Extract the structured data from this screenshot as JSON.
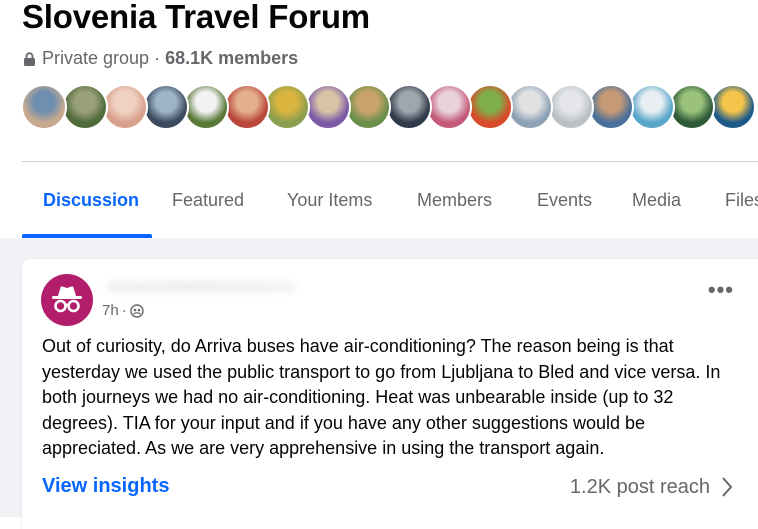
{
  "group": {
    "title": "Slovenia Travel Forum",
    "privacy": "Private group",
    "separator": "·",
    "members": "68.1K members"
  },
  "member_avatars": [
    {
      "colors": [
        "#c7a98f",
        "#6e8fb0"
      ]
    },
    {
      "colors": [
        "#4f6b3a",
        "#9aa07a"
      ]
    },
    {
      "colors": [
        "#d9a08c",
        "#f1d2c2"
      ]
    },
    {
      "colors": [
        "#3b4a5e",
        "#9db4c9"
      ]
    },
    {
      "colors": [
        "#5a7a3a",
        "#f2f2f2"
      ]
    },
    {
      "colors": [
        "#b9473b",
        "#e4b08f"
      ]
    },
    {
      "colors": [
        "#8a9f50",
        "#d9b43f"
      ]
    },
    {
      "colors": [
        "#7b5aa8",
        "#d8c3a5"
      ]
    },
    {
      "colors": [
        "#6c8f4a",
        "#c9a36a"
      ]
    },
    {
      "colors": [
        "#2f3a4a",
        "#a0a6ad"
      ]
    },
    {
      "colors": [
        "#c45a7a",
        "#e9d2dc"
      ]
    },
    {
      "colors": [
        "#d84a2a",
        "#7fae4a"
      ]
    },
    {
      "colors": [
        "#8da1b5",
        "#e2e2e2"
      ]
    },
    {
      "colors": [
        "#bcc0c4",
        "#e4e6eb"
      ]
    },
    {
      "colors": [
        "#4a6f9a",
        "#c79a76"
      ]
    },
    {
      "colors": [
        "#5aa6c9",
        "#e8eef2"
      ]
    },
    {
      "colors": [
        "#2e5a3a",
        "#9ac27a"
      ]
    },
    {
      "colors": [
        "#1d5a8a",
        "#f4c54a"
      ]
    }
  ],
  "tabs": [
    {
      "label": "Discussion",
      "active": true
    },
    {
      "label": "Featured",
      "active": false
    },
    {
      "label": "Your Items",
      "active": false
    },
    {
      "label": "Members",
      "active": false
    },
    {
      "label": "Events",
      "active": false
    },
    {
      "label": "Media",
      "active": false
    },
    {
      "label": "Files",
      "active": false
    }
  ],
  "post": {
    "author_avatar_icon": "incognito-icon",
    "time": "7h",
    "time_separator": "·",
    "audience_icon": "members-icon",
    "more_label": "•••",
    "text": "Out of curiosity, do Arriva buses have air-conditioning? The reason being is that yesterday we used the public transport to go from Ljubljana to Bled and vice versa. In both journeys we had no air-conditioning. Heat was unbearable inside  (up to 32 degrees). TIA for your input and if you have any other suggestions would be appreciated. As we are very apprehensive in using the transport again.",
    "insights_label": "View insights",
    "reach_label": "1.2K post reach"
  },
  "colors": {
    "accent": "#0866ff",
    "secondary_text": "#65676b",
    "feed_background": "#f0f2f5",
    "incognito_avatar": "#b21e6b"
  }
}
